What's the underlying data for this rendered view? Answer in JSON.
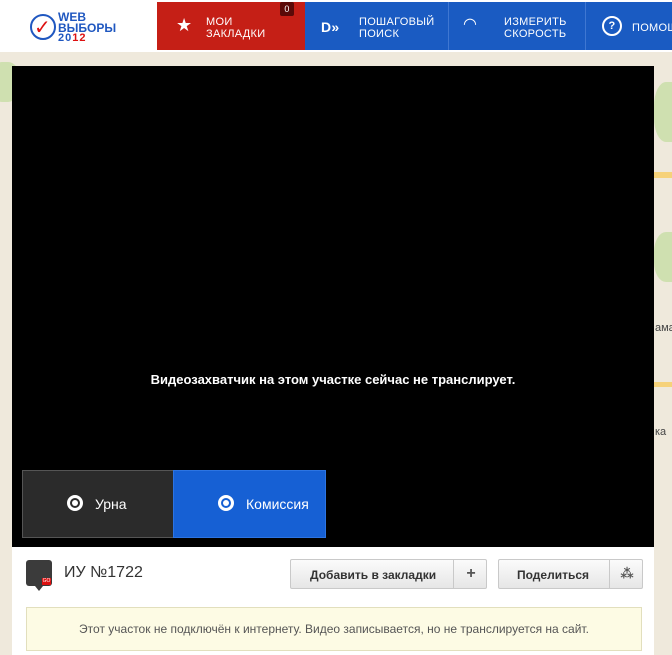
{
  "logo": {
    "line1": "WEB",
    "line2": "ВЫБОРЫ",
    "year_a": "20",
    "year_b": "12"
  },
  "nav": {
    "bookmarks": {
      "line1": "МОИ",
      "line2": "ЗАКЛАДКИ",
      "count": "0"
    },
    "steps": {
      "line1": "ПОШАГОВЫЙ",
      "line2": "ПОИСК"
    },
    "speed": {
      "line1": "ИЗМЕРИТЬ",
      "line2": "СКОРОСТЬ"
    },
    "help": {
      "line1": "ПОМОЩ"
    }
  },
  "video": {
    "message": "Видеозахватчик на этом участке сейчас не транслирует.",
    "tabs": [
      {
        "label": "Урна"
      },
      {
        "label": "Комиссия"
      }
    ]
  },
  "panel": {
    "title": "ИУ №1722",
    "bookmark_label": "Добавить в закладки",
    "bookmark_symbol": "+",
    "share_label": "Поделиться",
    "notice": "Этот участок не подключён к интернету. Видео записывается, но не транслируется на сайт."
  },
  "map": {
    "label_right1": "ама",
    "label_right2": "ка"
  },
  "colors": {
    "brand_red": "#c51f16",
    "brand_blue": "#1a5bc2",
    "active_tab": "#1660d4"
  }
}
